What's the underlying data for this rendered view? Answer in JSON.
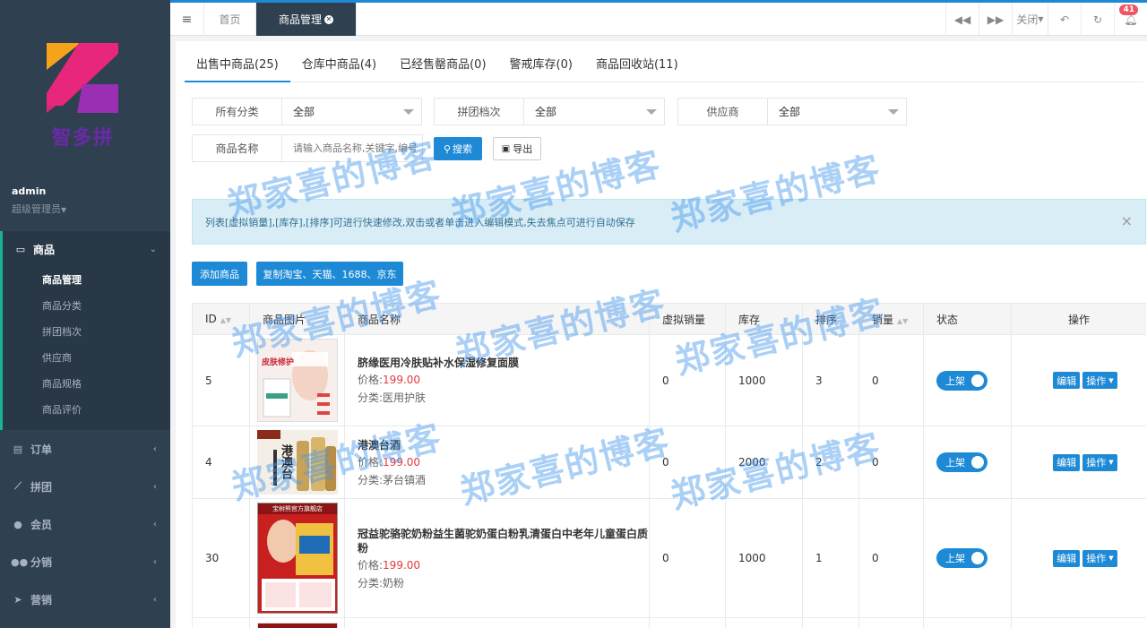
{
  "sidebar": {
    "logo_text": "智多拼",
    "user_name": "admin",
    "user_role": "超级管理员",
    "groups": [
      {
        "label": "商品",
        "icon": "laptop-icon",
        "open": true,
        "items": [
          "商品管理",
          "商品分类",
          "拼团档次",
          "供应商",
          "商品规格",
          "商品评价"
        ]
      },
      {
        "label": "订单",
        "icon": "document-icon"
      },
      {
        "label": "拼团",
        "icon": "line-chart-icon"
      },
      {
        "label": "会员",
        "icon": "user-icon"
      },
      {
        "label": "分销",
        "icon": "users-icon"
      },
      {
        "label": "营销",
        "icon": "send-icon"
      }
    ]
  },
  "topbar": {
    "home_tab": "首页",
    "active_tab": "商品管理",
    "close_label": "关闭",
    "notification_count": "41"
  },
  "tabs": [
    "出售中商品(25)",
    "仓库中商品(4)",
    "已经售罄商品(0)",
    "警戒库存(0)",
    "商品回收站(11)"
  ],
  "filters": {
    "category": {
      "label": "所有分类",
      "value": "全部"
    },
    "group_level": {
      "label": "拼团档次",
      "value": "全部"
    },
    "supplier": {
      "label": "供应商",
      "value": "全部"
    },
    "product_name": {
      "label": "商品名称",
      "placeholder": "请输入商品名称,关键字,编号"
    }
  },
  "buttons": {
    "search": "搜索",
    "export": "导出",
    "add_product": "添加商品",
    "copy_product": "复制淘宝、天猫、1688、京东"
  },
  "alert": "列表[虚拟销量],[库存],[排序]可进行快速修改,双击或者单击进入编辑模式,失去焦点可进行自动保存",
  "table": {
    "headers": [
      "ID",
      "商品图片",
      "商品名称",
      "虚拟销量",
      "库存",
      "排序",
      "销量",
      "状态",
      "操作"
    ],
    "price_prefix": "价格:",
    "category_prefix": "分类:",
    "rows": [
      {
        "id": "5",
        "name": "脐缘医用冷肤贴补水保湿修复面膜",
        "price": "199.00",
        "category": "医用护肤",
        "virtual_sales": "0",
        "stock": "1000",
        "sort": "3",
        "sales": "0",
        "status": "上架",
        "image_text": "皮肤修护",
        "image_colors": [
          "#f5e9e6",
          "#d44",
          "#fff"
        ]
      },
      {
        "id": "4",
        "name": "港澳台酒",
        "price": "199.00",
        "category": "茅台镇酒",
        "virtual_sales": "0",
        "stock": "2000",
        "sort": "2",
        "sales": "0",
        "status": "上架",
        "image_text": "港澳台",
        "image_colors": [
          "#f3efe6",
          "#c9a25a",
          "#8a2b1b"
        ]
      },
      {
        "id": "30",
        "name": "冠益驼骆驼奶粉益生菌驼奶蛋白粉乳清蛋白中老年儿童蛋白质粉",
        "price": "199.00",
        "category": "奶粉",
        "virtual_sales": "0",
        "stock": "1000",
        "sort": "1",
        "sales": "0",
        "status": "上架",
        "image_text": "宝树熊官方旗舰店",
        "image_colors": [
          "#c8201e",
          "#f0c040",
          "#fff"
        ]
      }
    ],
    "edit_label": "编辑",
    "ops_label": "操作"
  },
  "watermark": "郑家喜的博客",
  "colors": {
    "primary": "#1e8ad6",
    "sidebar_bg": "#2f4050",
    "badge": "#ed5565",
    "price": "#e4393c"
  }
}
